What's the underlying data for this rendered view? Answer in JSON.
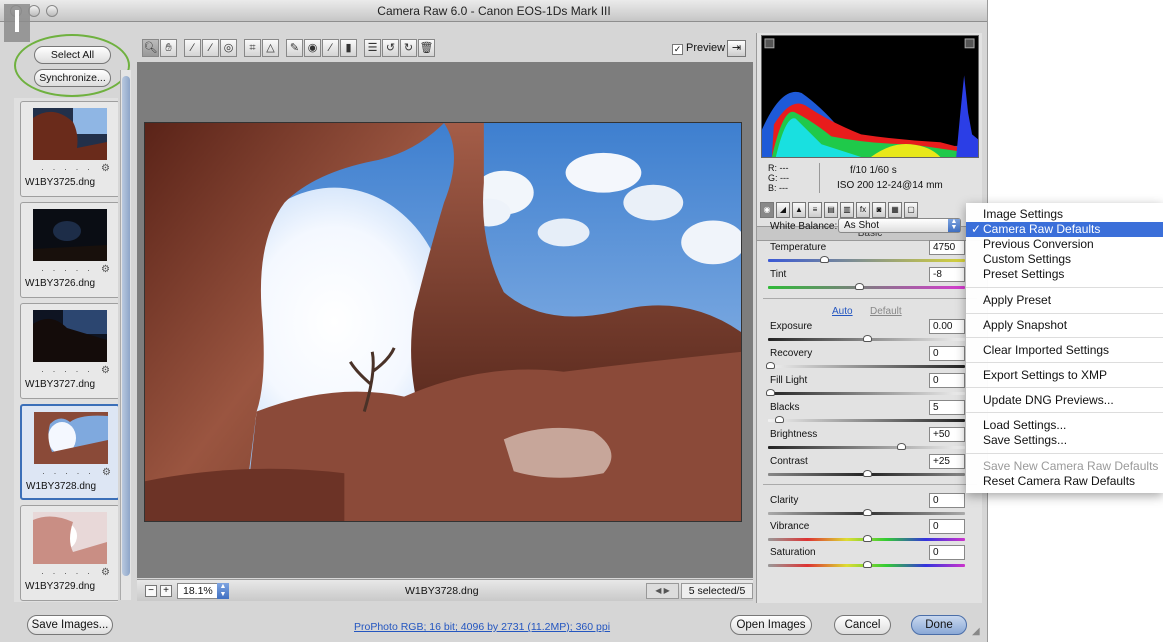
{
  "window": {
    "title": "Camera Raw 6.0  -  Canon EOS-1Ds Mark III"
  },
  "filmstrip": {
    "select_all": "Select All",
    "synchronize": "Synchronize...",
    "thumbnails": [
      {
        "name": "W1BY3725.dng",
        "selected": false
      },
      {
        "name": "W1BY3726.dng",
        "selected": false
      },
      {
        "name": "W1BY3727.dng",
        "selected": false
      },
      {
        "name": "W1BY3728.dng",
        "selected": true
      },
      {
        "name": "W1BY3729.dng",
        "selected": false
      }
    ],
    "rating_dots": "· · · · ·"
  },
  "toolbar": {
    "tools": [
      "zoom-tool",
      "hand-tool",
      "white-balance-tool",
      "color-sampler-tool",
      "targeted-adjustment-tool",
      "crop-tool",
      "straighten-tool",
      "spot-removal-tool",
      "red-eye-removal-tool",
      "adjustment-brush-tool",
      "graduated-filter-tool",
      "preferences",
      "rotate-ccw",
      "rotate-cw",
      "trash"
    ],
    "preview_label": "Preview",
    "preview_checked": true
  },
  "bottom_bar": {
    "zoom": "18.1%",
    "current_file": "W1BY3728.dng",
    "selection": "5 selected/5"
  },
  "readout": {
    "r": "R:   ---",
    "g": "G:   ---",
    "b": "B:   ---",
    "aperture_shutter": "f/10   1/60 s",
    "iso_lens": "ISO 200   12-24@14 mm"
  },
  "panel": {
    "header": "Basic",
    "wb_label": "White Balance:",
    "wb_value": "As Shot",
    "auto": "Auto",
    "default": "Default",
    "sliders": [
      {
        "label": "Temperature",
        "value": "4750"
      },
      {
        "label": "Tint",
        "value": "-8"
      },
      {
        "label": "Exposure",
        "value": "0.00"
      },
      {
        "label": "Recovery",
        "value": "0"
      },
      {
        "label": "Fill Light",
        "value": "0"
      },
      {
        "label": "Blacks",
        "value": "5"
      },
      {
        "label": "Brightness",
        "value": "+50"
      },
      {
        "label": "Contrast",
        "value": "+25"
      },
      {
        "label": "Clarity",
        "value": "0"
      },
      {
        "label": "Vibrance",
        "value": "0"
      },
      {
        "label": "Saturation",
        "value": "0"
      }
    ]
  },
  "footer": {
    "save_images": "Save Images...",
    "workflow": "ProPhoto RGB; 16 bit; 4096 by 2731 (11.2MP); 360 ppi",
    "open_images": "Open Images",
    "cancel": "Cancel",
    "done": "Done"
  },
  "menu": {
    "items": [
      {
        "label": "Image Settings"
      },
      {
        "label": "Camera Raw Defaults",
        "checked": true,
        "highlighted": true
      },
      {
        "label": "Previous Conversion"
      },
      {
        "label": "Custom Settings"
      },
      {
        "label": "Preset Settings"
      },
      {
        "label": "Apply Preset"
      },
      {
        "label": "Apply Snapshot"
      },
      {
        "label": "Clear Imported Settings"
      },
      {
        "label": "Export Settings to XMP"
      },
      {
        "label": "Update DNG Previews..."
      },
      {
        "label": "Load Settings..."
      },
      {
        "label": "Save Settings..."
      },
      {
        "label": "Save New Camera Raw Defaults",
        "disabled": true
      },
      {
        "label": "Reset Camera Raw Defaults"
      }
    ],
    "check": "✓"
  },
  "colors": {
    "accent": "#3b6fd9",
    "highlight_ring": "#6fb13f",
    "link": "#2456c0"
  }
}
